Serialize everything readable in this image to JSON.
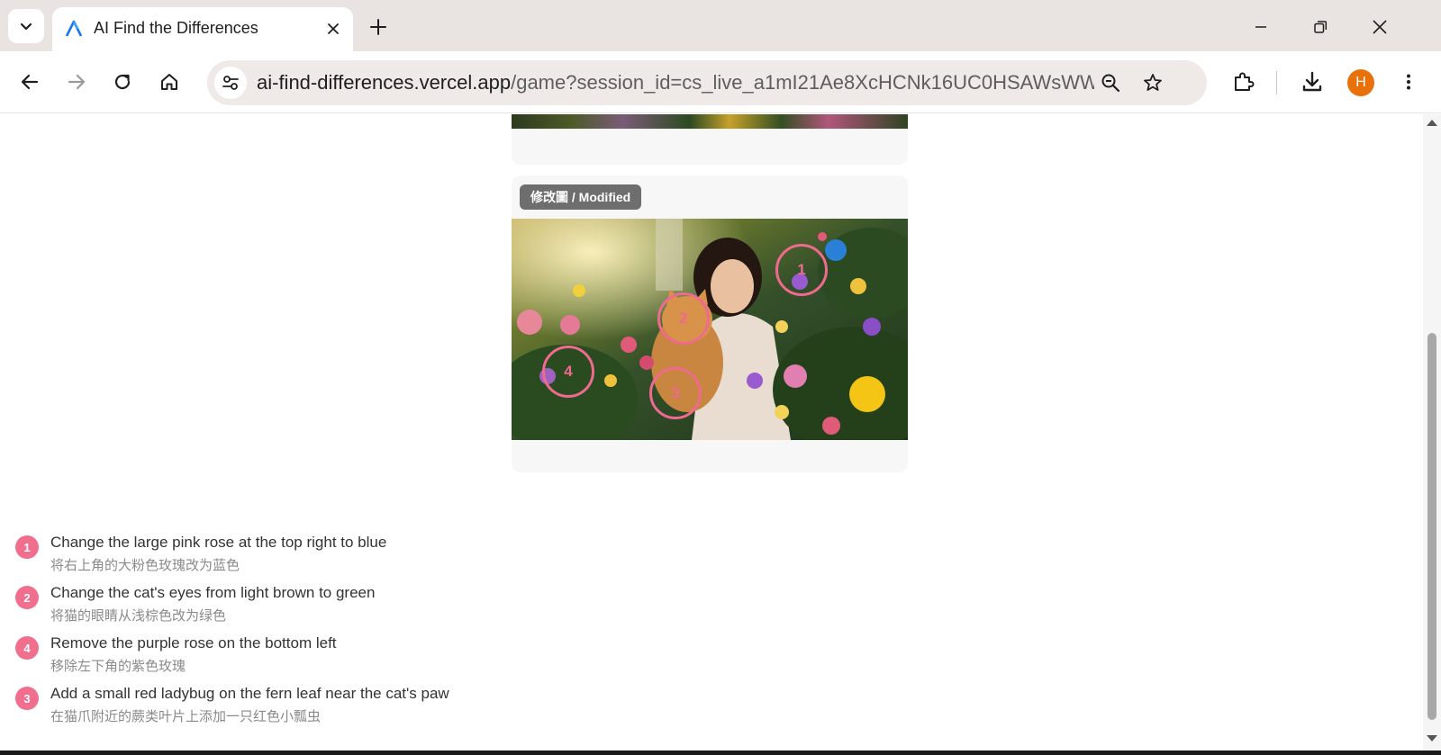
{
  "browser": {
    "tab": {
      "title": "AI Find the Differences"
    },
    "url": {
      "host": "ai-find-differences.vercel.app",
      "rest": "/game?session_id=cs_live_a1mI21Ae8XcHCNk16UC0HSAWsWW..."
    },
    "profile_initial": "H",
    "colors": {
      "tabstrip": "#e9e3e1",
      "omnibox": "#efeae7",
      "avatar": "#e8710a"
    }
  },
  "modified_card": {
    "label": "修改圖 / Modified",
    "markers": [
      "1",
      "2",
      "4",
      "3"
    ]
  },
  "differences": [
    {
      "num": "1",
      "en": "Change the large pink rose at the top right to blue",
      "zh": "将右上角的大粉色玫瑰改为蓝色"
    },
    {
      "num": "2",
      "en": "Change the cat's eyes from light brown to green",
      "zh": "将猫的眼睛从浅棕色改为绿色"
    },
    {
      "num": "4",
      "en": "Remove the purple rose on the bottom left",
      "zh": "移除左下角的紫色玫瑰"
    },
    {
      "num": "3",
      "en": "Add a small red ladybug on the fern leaf near the cat's paw",
      "zh": "在猫爪附近的蕨类叶片上添加一只红色小瓢虫"
    }
  ],
  "accent_color": "#ef6a8f"
}
